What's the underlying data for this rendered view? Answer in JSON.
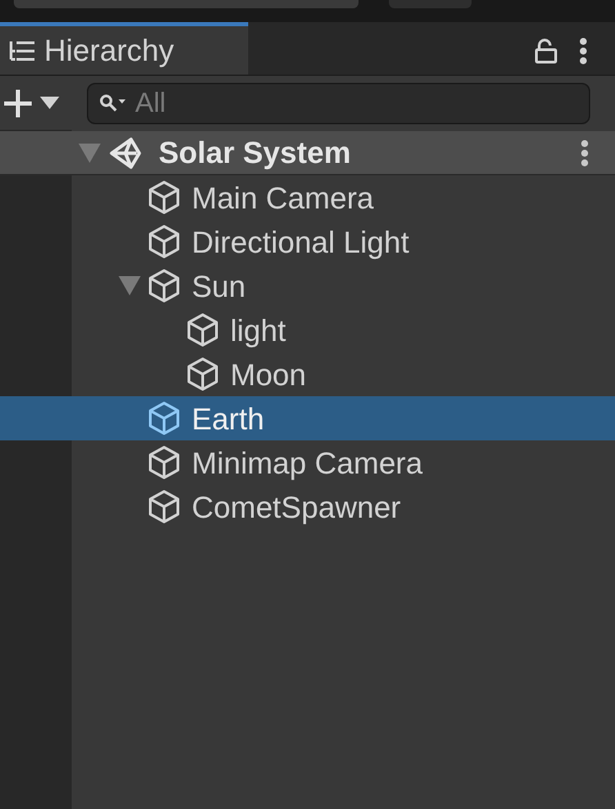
{
  "panel_tab": {
    "title": "Hierarchy",
    "selected": true
  },
  "search": {
    "placeholder": "All"
  },
  "scene": {
    "name": "Solar System",
    "expanded": true,
    "children": [
      {
        "name": "Main Camera",
        "selected": false
      },
      {
        "name": "Directional Light",
        "selected": false
      },
      {
        "name": "Sun",
        "selected": false,
        "expanded": true,
        "children": [
          {
            "name": "light",
            "selected": false
          },
          {
            "name": "Moon",
            "selected": false
          }
        ]
      },
      {
        "name": "Earth",
        "selected": true
      },
      {
        "name": "Minimap Camera",
        "selected": false
      },
      {
        "name": "CometSpawner",
        "selected": false
      }
    ]
  }
}
